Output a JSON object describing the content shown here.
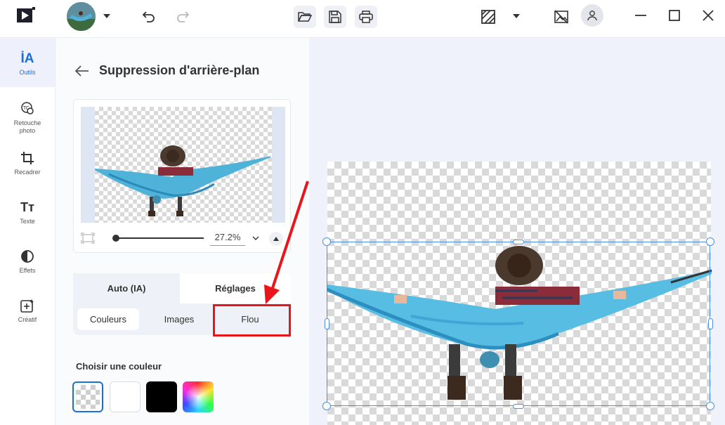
{
  "toolbar": {
    "app_logo": "play-logo-icon",
    "avatar": "user-photo-avatar",
    "undo": "undo-icon",
    "redo": "redo-icon",
    "open": "folder-open-icon",
    "save": "save-icon",
    "print": "print-icon",
    "compare": "compare-icon",
    "hide": "image-off-icon",
    "profile": "user-icon",
    "window_controls": [
      "minimize-icon",
      "maximize-icon",
      "close-icon"
    ]
  },
  "sidebar": {
    "items": [
      {
        "icon": "ia-icon",
        "icon_text": "İA",
        "label": "Outils",
        "active": true
      },
      {
        "icon": "retouch-icon",
        "label": "Retouche photo"
      },
      {
        "icon": "crop-icon",
        "label": "Recadrer"
      },
      {
        "icon": "text-icon",
        "icon_text": "Tт",
        "label": "Texte"
      },
      {
        "icon": "effects-icon",
        "label": "Effets"
      },
      {
        "icon": "creative-icon",
        "label": "Créatif"
      }
    ]
  },
  "panel": {
    "title": "Suppression d'arrière-plan",
    "zoom": "27.2%",
    "tabs": [
      "Auto (IA)",
      "Réglages"
    ],
    "subtabs": [
      "Couleurs",
      "Images",
      "Flou"
    ],
    "section_label": "Choisir une couleur",
    "swatches": [
      "transparent",
      "#ffffff",
      "#000000",
      "rainbow"
    ]
  },
  "colors": {
    "accent": "#1a6fd8",
    "annotation": "#e8161a",
    "selection": "#4a90e2"
  }
}
